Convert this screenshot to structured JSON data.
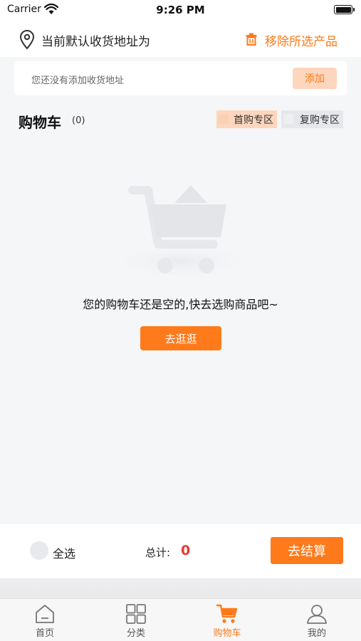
{
  "status_bar": {
    "carrier": "Carrier",
    "time": "9:26 PM"
  },
  "address": {
    "title": "当前默认收货地址为",
    "remove_label": "移除所选产品",
    "empty_text": "您还没有添加收货地址",
    "add_label": "添加"
  },
  "cart": {
    "title": "购物车",
    "count": "(0)",
    "zones": [
      {
        "label": "首购专区"
      },
      {
        "label": "复购专区"
      }
    ],
    "empty_message": "您的购物车还是空的,快去选购商品吧~",
    "browse_label": "去逛逛"
  },
  "checkout": {
    "select_all": "全选",
    "total_label": "总计:",
    "total_value": "0",
    "checkout_label": "去结算"
  },
  "tabs": [
    {
      "label": "首页",
      "icon": "home-icon"
    },
    {
      "label": "分类",
      "icon": "grid-icon"
    },
    {
      "label": "购物车",
      "icon": "cart-icon",
      "active": true
    },
    {
      "label": "我的",
      "icon": "user-icon"
    }
  ],
  "colors": {
    "accent": "#ff7a1a",
    "accent_light": "#fdd6bd",
    "total_red": "#e53935",
    "background": "#f5f6f8"
  }
}
